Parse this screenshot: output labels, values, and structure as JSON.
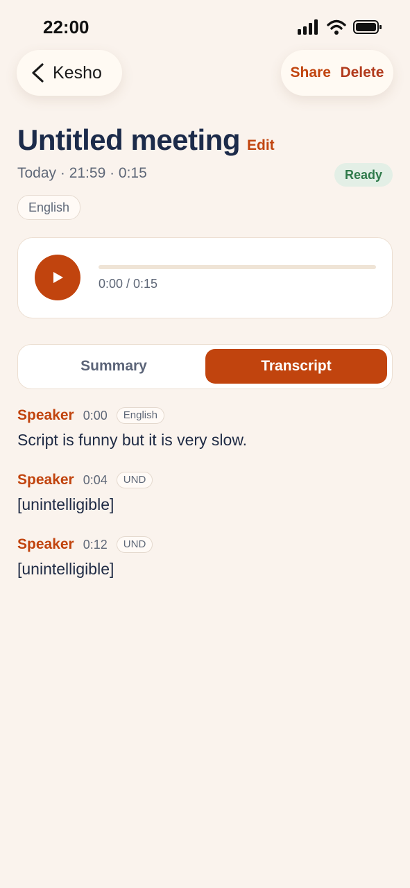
{
  "status_bar": {
    "time": "22:00",
    "icons": [
      "signal-icon",
      "wifi-icon",
      "battery-icon"
    ]
  },
  "nav": {
    "back_label": "Kesho",
    "share_label": "Share",
    "delete_label": "Delete"
  },
  "meeting": {
    "title": "Untitled meeting",
    "edit_label": "Edit",
    "meta": "Today · 21:59 · 0:15",
    "status": "Ready",
    "language": "English"
  },
  "player": {
    "time_text": "0:00 / 0:15",
    "progress": 0
  },
  "tabs": {
    "summary_label": "Summary",
    "transcript_label": "Transcript",
    "selected": "Transcript"
  },
  "transcript": [
    {
      "speaker": "Speaker",
      "time": "0:00",
      "lang": "English",
      "text": "Script is funny but it is very slow."
    },
    {
      "speaker": "Speaker",
      "time": "0:04",
      "lang": "UND",
      "text": "[unintelligible]"
    },
    {
      "speaker": "Speaker",
      "time": "0:12",
      "lang": "UND",
      "text": "[unintelligible]"
    }
  ],
  "colors": {
    "accent": "#c1440e",
    "background": "#faf3ed",
    "ready_bg": "#e3efe6",
    "ready_text": "#2f7a4a"
  }
}
